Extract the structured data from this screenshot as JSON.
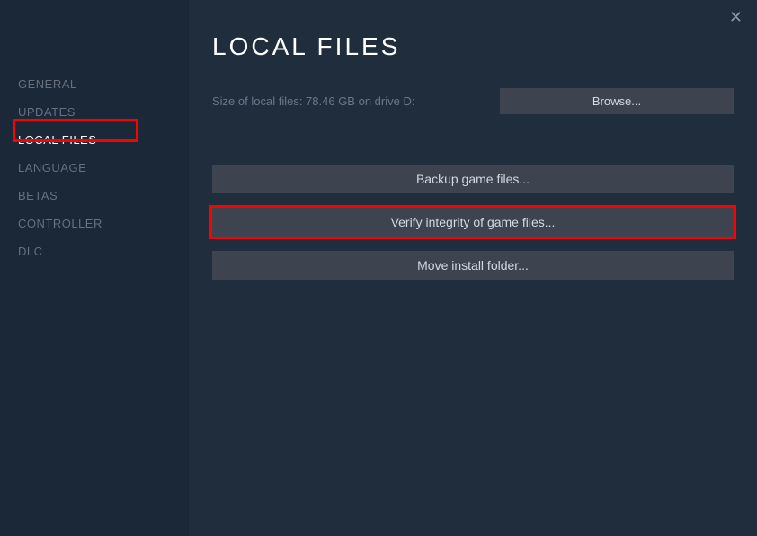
{
  "sidebar": {
    "items": [
      {
        "label": "GENERAL",
        "active": false
      },
      {
        "label": "UPDATES",
        "active": false
      },
      {
        "label": "LOCAL FILES",
        "active": true
      },
      {
        "label": "LANGUAGE",
        "active": false
      },
      {
        "label": "BETAS",
        "active": false
      },
      {
        "label": "CONTROLLER",
        "active": false
      },
      {
        "label": "DLC",
        "active": false
      }
    ]
  },
  "main": {
    "title": "LOCAL FILES",
    "size_label": "Size of local files: 78.46 GB on drive D:",
    "browse_label": "Browse...",
    "backup_label": "Backup game files...",
    "verify_label": "Verify integrity of game files...",
    "move_label": "Move install folder..."
  },
  "close_glyph": "✕"
}
